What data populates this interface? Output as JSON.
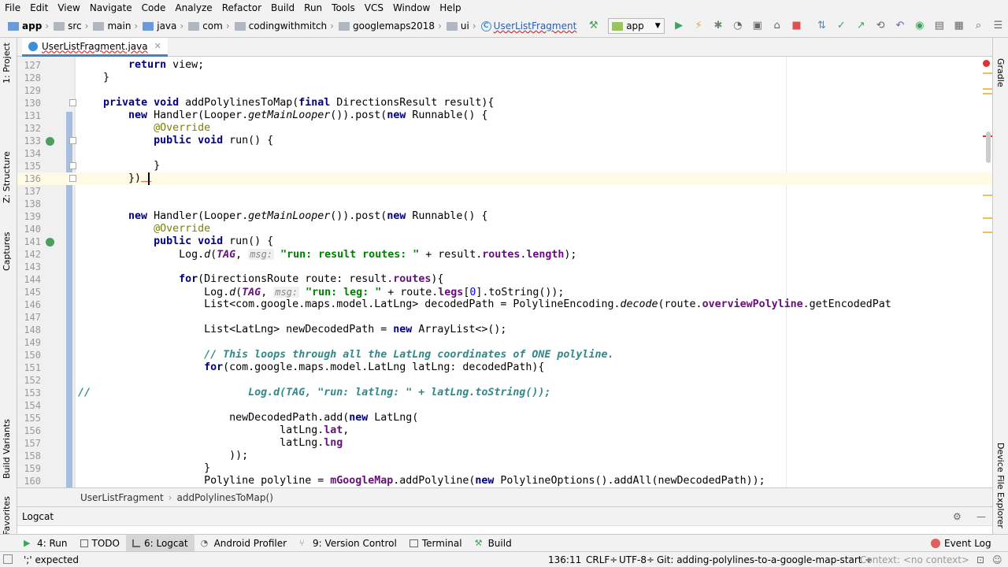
{
  "menu": [
    "File",
    "Edit",
    "View",
    "Navigate",
    "Code",
    "Analyze",
    "Refactor",
    "Build",
    "Run",
    "Tools",
    "VCS",
    "Window",
    "Help"
  ],
  "nav": {
    "project": "app",
    "crumbs": [
      "src",
      "main",
      "java",
      "com",
      "codingwithmitch",
      "googlemaps2018",
      "ui",
      "UserListFragment"
    ],
    "run_config": "app"
  },
  "tab": {
    "label": "UserListFragment.java"
  },
  "left_tabs": [
    "1: Project",
    "Z: Structure",
    "Captures",
    "Build Variants",
    "2: Favorites"
  ],
  "right_tabs": [
    "Gradle",
    "Device File Explorer"
  ],
  "code_lines": [
    {
      "n": "127"
    },
    {
      "n": "128"
    },
    {
      "n": "129"
    },
    {
      "n": "130"
    },
    {
      "n": "131"
    },
    {
      "n": "132"
    },
    {
      "n": "133"
    },
    {
      "n": "134"
    },
    {
      "n": "135"
    },
    {
      "n": "136"
    },
    {
      "n": "137"
    },
    {
      "n": "138"
    },
    {
      "n": "139"
    },
    {
      "n": "140"
    },
    {
      "n": "141"
    },
    {
      "n": "142"
    },
    {
      "n": "143"
    },
    {
      "n": "144"
    },
    {
      "n": "145"
    },
    {
      "n": "146"
    },
    {
      "n": "147"
    },
    {
      "n": "148"
    },
    {
      "n": "149"
    },
    {
      "n": "150"
    },
    {
      "n": "151"
    },
    {
      "n": "152"
    },
    {
      "n": "153"
    },
    {
      "n": "154"
    },
    {
      "n": "155"
    },
    {
      "n": "156"
    },
    {
      "n": "157"
    },
    {
      "n": "158"
    },
    {
      "n": "159"
    },
    {
      "n": "160"
    }
  ],
  "breadcrumbs": {
    "cls": "UserListFragment",
    "method": "addPolylinesToMap()"
  },
  "logcat": {
    "label": "Logcat"
  },
  "toolwindows": [
    {
      "label": "4: Run",
      "icon": "run-icon"
    },
    {
      "label": "TODO",
      "icon": "todo-icon"
    },
    {
      "label": "6: Logcat",
      "icon": "logcat-icon"
    },
    {
      "label": "Android Profiler",
      "icon": "profiler-icon"
    },
    {
      "label": "9: Version Control",
      "icon": "vcs-icon"
    },
    {
      "label": "Terminal",
      "icon": "terminal-icon"
    },
    {
      "label": "Build",
      "icon": "build-icon"
    }
  ],
  "event_log": "Event Log",
  "status": {
    "message": "';' expected",
    "position": "136:11",
    "line_sep": "CRLF÷",
    "encoding": "UTF-8÷",
    "git": "Git: adding-polylines-to-a-google-map-start ÷",
    "context": "Context: <no context>"
  }
}
